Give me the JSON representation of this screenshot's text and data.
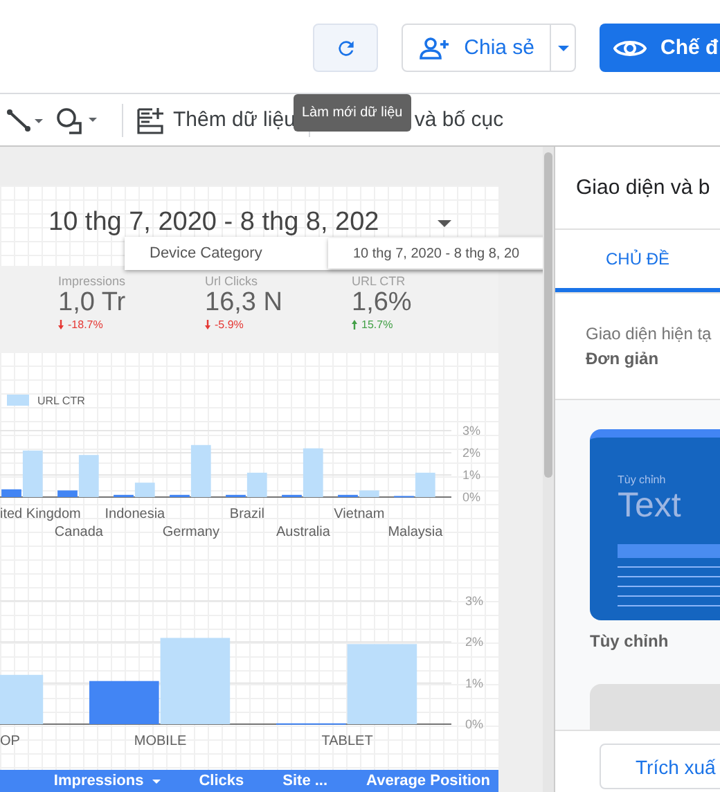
{
  "header": {
    "refresh_tooltip": "Làm mới dữ liệu",
    "share_button": "Chia sẻ",
    "view_button": "Chế đ"
  },
  "toolbar": {
    "add_data": "Thêm dữ liệu",
    "theme_layout": "và bố cục"
  },
  "report": {
    "date_range": "10 thg 7, 2020 - 8 thg 8, 202",
    "overlay": {
      "dimension": "Device Category",
      "date_range": "10 thg 7, 2020 - 8 thg 8, 20"
    },
    "scorecards": [
      {
        "label": "Impressions",
        "value": "1,0 Tr",
        "delta": "-18.7%",
        "kind": "down"
      },
      {
        "label": "Url Clicks",
        "value": "16,3 N",
        "delta": "-5.9%",
        "kind": "down"
      },
      {
        "label": "URL CTR",
        "value": "1,6%",
        "delta": "15.7%",
        "kind": "up"
      }
    ],
    "country_chart": {
      "chart_data": {
        "type": "bar",
        "categories": [
          "ited Kingdom",
          "Canada",
          "Indonesia",
          "Germany",
          "Brazil",
          "Australia",
          "Vietnam",
          "Malaysia"
        ],
        "series": [
          {
            "color": "#4285f4",
            "values": [
              0.35,
              0.3,
              0.1,
              0.1,
              0.1,
              0.1,
              0.1,
              0.05
            ]
          },
          {
            "name": "URL CTR",
            "color": "#bbdefb",
            "values": [
              2.1,
              1.9,
              0.65,
              2.35,
              1.1,
              2.2,
              0.3,
              1.1
            ]
          }
        ],
        "ylim": [
          0,
          3
        ],
        "yticks": [
          {
            "value": 0,
            "label": "0%"
          },
          {
            "value": 1,
            "label": "1%"
          },
          {
            "value": 2,
            "label": "2%"
          },
          {
            "value": 3,
            "label": "3%"
          }
        ]
      }
    },
    "device_chart": {
      "chart_data": {
        "type": "bar",
        "categories": [
          "OP",
          "MOBILE",
          "TABLET"
        ],
        "series": [
          {
            "color": "#4285f4",
            "values": [
              null,
              1.05,
              0.02
            ]
          },
          {
            "color": "#bbdefb",
            "values": [
              1.2,
              2.1,
              1.95
            ]
          }
        ],
        "ylim": [
          0,
          3
        ],
        "yticks": [
          {
            "value": 0,
            "label": "0%"
          },
          {
            "value": 1,
            "label": "1%"
          },
          {
            "value": 2,
            "label": "2%"
          },
          {
            "value": 3,
            "label": "3%"
          }
        ]
      }
    },
    "table": {
      "columns": [
        {
          "label": "Impressions",
          "sorted": true
        },
        {
          "label": "Clicks",
          "sorted": false
        },
        {
          "label": "Site ...",
          "sorted": false
        },
        {
          "label": "Average Position",
          "sorted": false
        }
      ]
    }
  },
  "panel": {
    "title": "Giao diện và b",
    "tabs": [
      {
        "label": "CHỦ ĐỀ",
        "selected": true
      }
    ],
    "current_theme_label": "Giao diện hiện tạ",
    "current_theme": "Đơn giản",
    "theme_card": {
      "small": "Tùy chỉnh",
      "big": "Text",
      "name": "Tùy chỉnh"
    },
    "extract_button": "Trích xuấ"
  }
}
